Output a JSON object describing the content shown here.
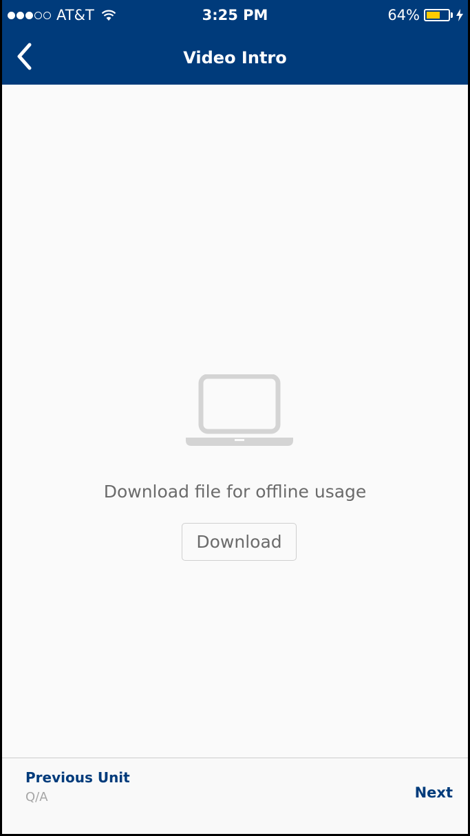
{
  "status_bar": {
    "carrier": "AT&T",
    "signal_filled": 3,
    "signal_total": 5,
    "time": "3:25 PM",
    "battery_percent": "64%",
    "battery_level": 0.64,
    "battery_color": "#ffcc00",
    "icons": [
      "signal-icon",
      "wifi-icon",
      "battery-icon",
      "charging-bolt-icon"
    ]
  },
  "nav": {
    "title": "Video Intro",
    "back_icon": "chevron-left-icon"
  },
  "main": {
    "icon": "laptop-icon",
    "message": "Download file for offline usage",
    "download_label": "Download"
  },
  "footer": {
    "previous_label": "Previous Unit",
    "previous_subtitle": "Q/A",
    "next_label": "Next"
  },
  "colors": {
    "brand": "#003b7b",
    "accent_text": "#003b7b",
    "muted_text": "#6b6b6b",
    "subtle_text": "#a6a6a6",
    "background": "#fafafa"
  }
}
